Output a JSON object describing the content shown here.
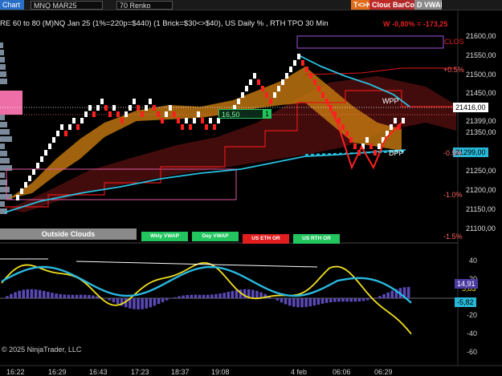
{
  "toolbar": {
    "title": "Chart",
    "instrument": "MNQ MAR25",
    "bar_type": "70 Renko",
    "buttons": [
      {
        "label": "T<>K",
        "color": "#e06a1a"
      },
      {
        "label": "Cloud",
        "color": "#c02828"
      },
      {
        "label": "BarCol",
        "color": "#b02a2a"
      },
      {
        "label": "D VWAP",
        "color": "#8a8a8a"
      }
    ]
  },
  "chart": {
    "info_line": "RE 60 to 80 (M)NQ Jan 25 (1%=220p=$440) (1 Brick=$30<>$40), US Daily % , RTH TPO 30 Min",
    "performance": "W -0,80% = -173,25",
    "copyright": "© 2025 NinjaTrader, LLC",
    "price_axis": [
      "21600,00",
      "21550,00",
      "21500,00",
      "21450,00",
      "21399,00",
      "21350,00",
      "21250,00",
      "21200,00",
      "21150,00",
      "21100,00"
    ],
    "price_tags": {
      "last": {
        "label": "21416,00",
        "bg": "#ffffff",
        "fg": "#000000"
      },
      "dpp": {
        "label": "21299,00",
        "bg": "#27b8d8",
        "fg": "#000000"
      }
    },
    "pct_labels": [
      "+0.5%",
      "-0.5%",
      "-1.0%",
      "-1.5%"
    ],
    "level_labels": {
      "wpp": "WPP",
      "dpp": "DPP",
      "clo": "CLOS"
    },
    "inline_tag": {
      "value": "16,50",
      "count": "1"
    },
    "buttons": [
      {
        "label": "Outside Clouds",
        "bg": "#8a8a8a",
        "fg": "#ffffff"
      },
      {
        "label": "Wkly VWAP",
        "bg": "#22c55e",
        "fg": "#ffffff"
      },
      {
        "label": "Day VWAP",
        "bg": "#22c55e",
        "fg": "#ffffff"
      },
      {
        "label": "US ETH OR",
        "bg": "#e11d1d",
        "fg": "#ffffff"
      },
      {
        "label": "US RTH OR",
        "bg": "#22c55e",
        "fg": "#ffffff"
      }
    ],
    "osc_axis": [
      "40",
      "20",
      "-20",
      "-40",
      "-60"
    ],
    "osc_tags": {
      "a": {
        "label": "14,91",
        "bg": "#4b3aa0",
        "fg": "#ffffff"
      },
      "b": {
        "label": "-5,82",
        "bg": "#27b8d8",
        "fg": "#000000"
      },
      "c": {
        "label": "5,83"
      }
    },
    "time_axis": [
      "16:22",
      "16:29",
      "16:43",
      "17:23",
      "18:37",
      "19:08",
      "4 feb",
      "06:06",
      "06:29"
    ]
  },
  "colors": {
    "bull_brick": "#ffffff",
    "bear_brick": "#ff2020",
    "cloud_orange": "#c87a10",
    "cloud_dark": "#5a1010",
    "vwap_cyan": "#2ac0e0",
    "osc_yellow": "#f2e020",
    "osc_cyan": "#2ab8e0",
    "histogram": "#5a4ab8"
  }
}
